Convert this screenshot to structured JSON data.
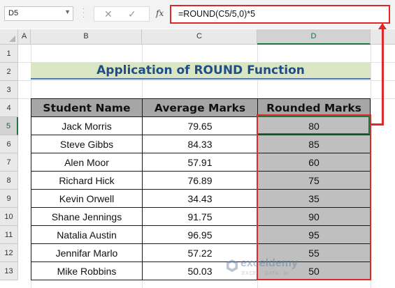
{
  "formula_bar": {
    "name_box": "D5",
    "fx_label": "fx",
    "cancel_glyph": "✕",
    "enter_glyph": "✓",
    "formula": "=ROUND(C5/5,0)*5"
  },
  "columns": [
    "A",
    "B",
    "C",
    "D"
  ],
  "rows": [
    "1",
    "2",
    "3",
    "4",
    "5",
    "6",
    "7",
    "8",
    "9",
    "10",
    "11",
    "12",
    "13"
  ],
  "title": "Application of ROUND Function",
  "table": {
    "headers": [
      "Student Name",
      "Average Marks",
      "Rounded Marks"
    ],
    "rows": [
      {
        "name": "Jack Morris",
        "avg": "79.65",
        "rounded": "80"
      },
      {
        "name": "Steve Gibbs",
        "avg": "84.33",
        "rounded": "85"
      },
      {
        "name": "Alen Moor",
        "avg": "57.91",
        "rounded": "60"
      },
      {
        "name": "Richard Hick",
        "avg": "76.89",
        "rounded": "75"
      },
      {
        "name": "Kevin Orwell",
        "avg": "34.43",
        "rounded": "35"
      },
      {
        "name": "Shane Jennings",
        "avg": "91.75",
        "rounded": "90"
      },
      {
        "name": "Natalia Austin",
        "avg": "96.95",
        "rounded": "95"
      },
      {
        "name": "Jennifar Marlo",
        "avg": "57.22",
        "rounded": "55"
      },
      {
        "name": "Mike Robbins",
        "avg": "50.03",
        "rounded": "50"
      }
    ]
  },
  "watermark": {
    "name": "exceldemy",
    "tagline": "EXCEL · DATA · BI"
  },
  "colors": {
    "highlight_red": "#e32626",
    "title_bg": "#d9e5c3",
    "title_text": "#1f4e87",
    "header_bg": "#a6a6a6",
    "rounded_col_bg": "#bfbfbf",
    "excel_green": "#217346"
  },
  "icons": {
    "name_box_dropdown": "chevron-down-icon",
    "fx": "function-icon",
    "watermark_logo": "exceldemy-logo-icon"
  }
}
